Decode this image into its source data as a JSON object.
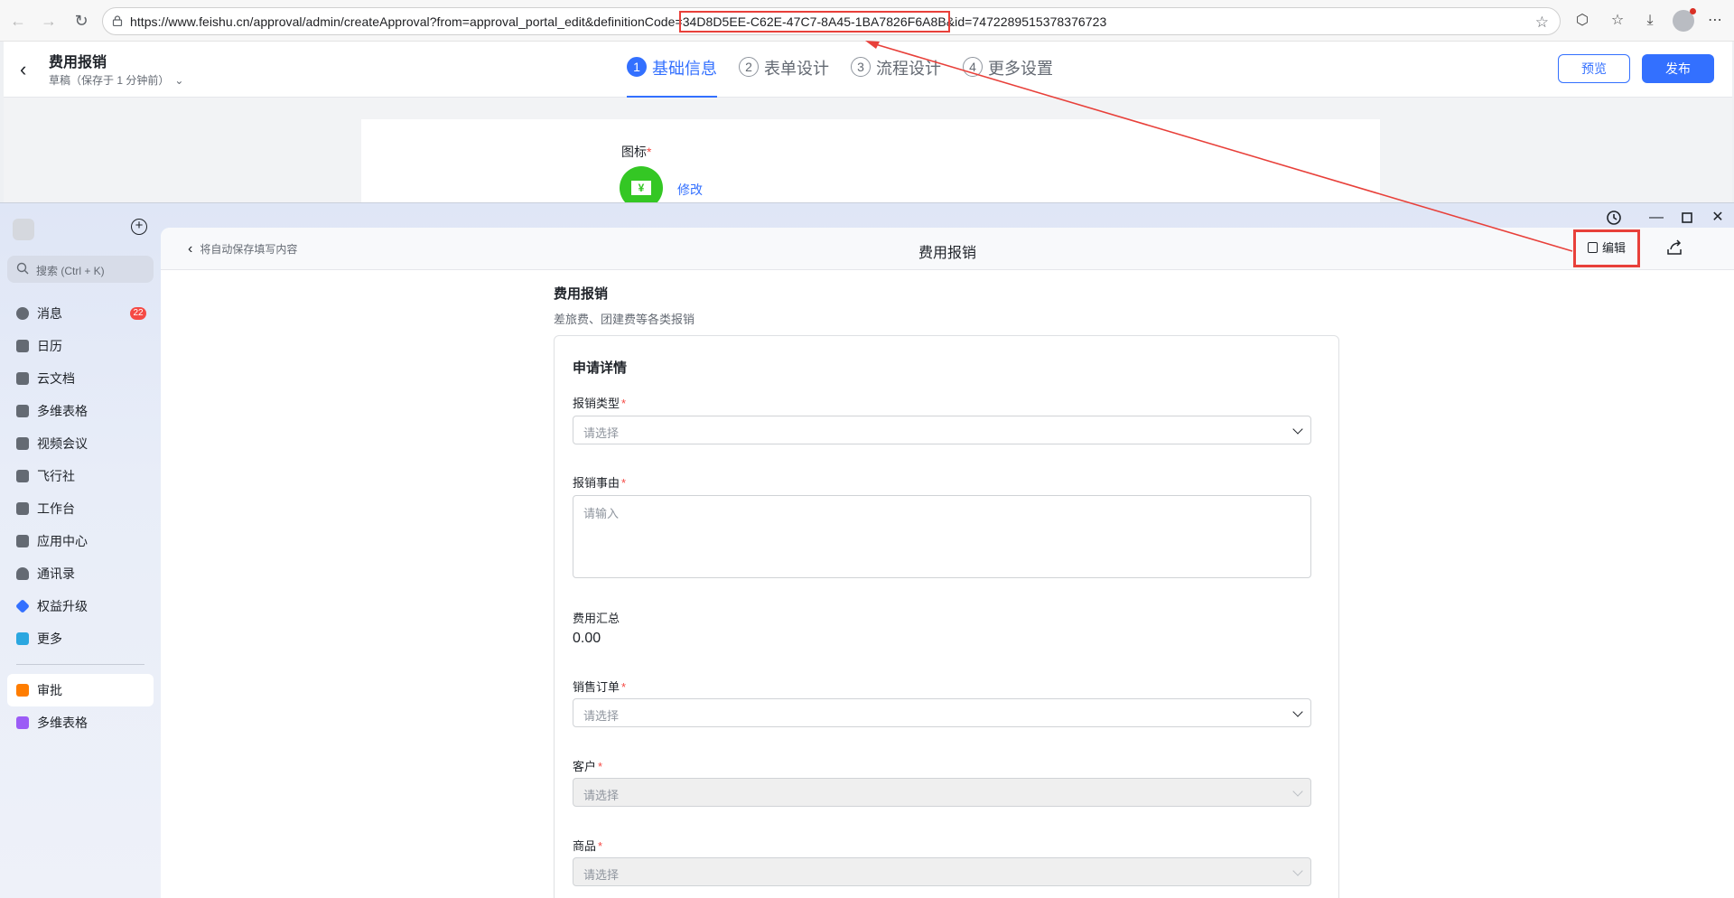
{
  "browser": {
    "url_prefix": "https://www.feishu.cn/approval/admin/createApproval?from=approval_portal_edit&definitionCode=",
    "url_highlight": "34D8D5EE-C62E-47C7-8A45-1BA7826F6A8B",
    "url_suffix": "&id=7472289515378376723"
  },
  "admin": {
    "title": "费用报销",
    "draft_status": "草稿（保存于 1 分钟前）",
    "steps": [
      {
        "num": "1",
        "label": "基础信息"
      },
      {
        "num": "2",
        "label": "表单设计"
      },
      {
        "num": "3",
        "label": "流程设计"
      },
      {
        "num": "4",
        "label": "更多设置"
      }
    ],
    "preview_label": "预览",
    "publish_label": "发布",
    "icon_label": "图标",
    "icon_glyph": "¥",
    "modify_label": "修改"
  },
  "client": {
    "search_placeholder": "搜索 (Ctrl + K)",
    "nav": [
      {
        "label": "消息",
        "badge": "22",
        "color": "#646a73"
      },
      {
        "label": "日历",
        "color": "#646a73"
      },
      {
        "label": "云文档",
        "color": "#646a73"
      },
      {
        "label": "多维表格",
        "color": "#646a73"
      },
      {
        "label": "视频会议",
        "color": "#646a73"
      },
      {
        "label": "飞行社",
        "color": "#646a73"
      },
      {
        "label": "工作台",
        "color": "#646a73"
      },
      {
        "label": "应用中心",
        "color": "#646a73"
      },
      {
        "label": "通讯录",
        "color": "#646a73"
      },
      {
        "label": "权益升级",
        "color": "#3370ff"
      },
      {
        "label": "更多",
        "color": "#2ba7e0"
      }
    ],
    "pinned": [
      {
        "label": "审批",
        "color": "#ff7d00"
      },
      {
        "label": "多维表格",
        "color": "#9b5cf6"
      }
    ],
    "back_label": "将自动保存填写内容",
    "form_title": "费用报销",
    "edit_label": "编辑"
  },
  "form": {
    "title": "费用报销",
    "description": "差旅费、团建费等各类报销",
    "section": "申请详情",
    "fields": {
      "type": {
        "label": "报销类型",
        "placeholder": "请选择"
      },
      "reason": {
        "label": "报销事由",
        "placeholder": "请输入"
      },
      "summary": {
        "label": "费用汇总",
        "value": "0.00"
      },
      "order": {
        "label": "销售订单",
        "placeholder": "请选择"
      },
      "customer": {
        "label": "客户",
        "placeholder": "请选择"
      },
      "product": {
        "label": "商品",
        "placeholder": "请选择"
      }
    },
    "required_mark": "*"
  },
  "colors": {
    "accent": "#3370ff",
    "annotation": "#e8403a",
    "required": "#f54a45"
  }
}
